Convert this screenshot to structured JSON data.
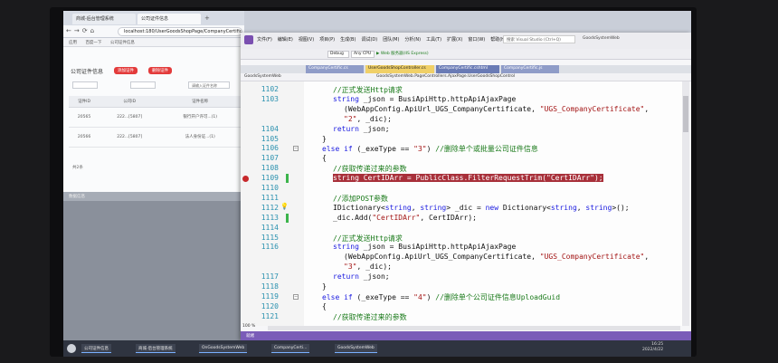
{
  "browser": {
    "tabs": [
      "商城-后台管理系统",
      "公司证件信息"
    ],
    "url": "localhost:180/UserGoodsShopPage/CompanyCertific.aspx",
    "bookmarks": [
      "应用",
      "百度一下",
      "公司证件信息"
    ],
    "panel_title": "公司证件信息",
    "buttons": [
      "添加证件",
      "删除证件"
    ],
    "search_placeholder": "请输入证件名称",
    "table": {
      "headers": [
        "",
        "证件ID",
        "公司ID",
        "证件名称"
      ],
      "rows": [
        [
          "",
          "20565",
          "222...[5807]",
          "银行开户许可...(1)"
        ],
        [
          "",
          "20566",
          "222...[5807]",
          "法人身份证...(1)"
        ]
      ]
    },
    "pager": "共2条",
    "footer": "数据信息"
  },
  "vs": {
    "menu": [
      "文件(F)",
      "编辑(E)",
      "视图(V)",
      "项目(P)",
      "生成(B)",
      "调试(D)",
      "团队(M)",
      "分析(N)",
      "工具(T)",
      "扩展(X)",
      "窗口(W)",
      "帮助(H)"
    ],
    "quick_launch": "搜索 Visual Studio (Ctrl+Q)",
    "user": "GoodsSystemWeb",
    "config": "Debug",
    "platform": "Any CPU",
    "run_label": "▶ Web 服务器(IIS Express)",
    "tabs": [
      "CompanyCertific.cs",
      "UserGoodsShopController.cs",
      "CompanyCertific.cshtml",
      "CompanyCertific.js"
    ],
    "active_tab_index": 1,
    "nav": [
      "GoodsSystemWeb",
      "GoodsSystemWeb.PageControllers.AjaxPage.UserGoodsShopControl"
    ],
    "zoom": "100 %",
    "status": "就绪",
    "output": "错误列表 输出",
    "position": "行 1113  列 35  字符 35  Ins"
  },
  "code_lines": [
    {
      "num": "1102",
      "indent": 2,
      "parts": [
        {
          "t": "//正式发送Http请求",
          "c": "cm"
        }
      ]
    },
    {
      "num": "1103",
      "indent": 2,
      "parts": [
        {
          "t": "string",
          "c": "kw"
        },
        {
          "t": " _json = BusiApiHttp.httpApiAjaxPage"
        }
      ]
    },
    {
      "num": "",
      "indent": 3,
      "parts": [
        {
          "t": "(WebAppConfig.ApiUrl_UGS_CompanyCertificate, "
        },
        {
          "t": "\"UGS_CompanyCertificate\"",
          "c": "str"
        },
        {
          "t": ","
        }
      ]
    },
    {
      "num": "",
      "indent": 3,
      "parts": [
        {
          "t": "\"2\"",
          "c": "str"
        },
        {
          "t": ", _dic);"
        }
      ]
    },
    {
      "num": "1104",
      "indent": 2,
      "parts": [
        {
          "t": "return",
          "c": "kw"
        },
        {
          "t": " _json;"
        }
      ]
    },
    {
      "num": "1105",
      "indent": 1,
      "parts": [
        {
          "t": "}"
        }
      ]
    },
    {
      "num": "1106",
      "indent": 1,
      "fold": true,
      "parts": [
        {
          "t": "else if",
          "c": "kw"
        },
        {
          "t": " (_exeType == "
        },
        {
          "t": "\"3\"",
          "c": "str"
        },
        {
          "t": ") "
        },
        {
          "t": "//删除单个或批量公司证件信息",
          "c": "cm"
        }
      ]
    },
    {
      "num": "1107",
      "indent": 1,
      "parts": [
        {
          "t": "{"
        }
      ]
    },
    {
      "num": "1108",
      "indent": 2,
      "parts": [
        {
          "t": "//获取传递过来的参数",
          "c": "cm"
        }
      ]
    },
    {
      "num": "1109",
      "indent": 2,
      "bp": true,
      "chg": true,
      "highlight": true,
      "parts": [
        {
          "t": "string CertIDArr = PublicClass.FilterRequestTrim(\"CertIDArr\");"
        }
      ]
    },
    {
      "num": "1110",
      "indent": 2,
      "parts": []
    },
    {
      "num": "1111",
      "indent": 2,
      "parts": [
        {
          "t": "//添加POST参数",
          "c": "cm"
        }
      ]
    },
    {
      "num": "1112",
      "indent": 2,
      "bulb": true,
      "parts": [
        {
          "t": "IDictionary<"
        },
        {
          "t": "string",
          "c": "kw"
        },
        {
          "t": ", "
        },
        {
          "t": "string",
          "c": "kw"
        },
        {
          "t": "> _dic = "
        },
        {
          "t": "new",
          "c": "kw"
        },
        {
          "t": " Dictionary<"
        },
        {
          "t": "string",
          "c": "kw"
        },
        {
          "t": ", "
        },
        {
          "t": "string",
          "c": "kw"
        },
        {
          "t": ">();"
        }
      ]
    },
    {
      "num": "1113",
      "indent": 2,
      "chg": true,
      "parts": [
        {
          "t": "_dic.Add("
        },
        {
          "t": "\"CertIDArr\"",
          "c": "str"
        },
        {
          "t": ", CertIDArr);"
        }
      ]
    },
    {
      "num": "1114",
      "indent": 2,
      "parts": []
    },
    {
      "num": "1115",
      "indent": 2,
      "parts": [
        {
          "t": "//正式发送Http请求",
          "c": "cm"
        }
      ]
    },
    {
      "num": "1116",
      "indent": 2,
      "parts": [
        {
          "t": "string",
          "c": "kw"
        },
        {
          "t": " _json = BusiApiHttp.httpApiAjaxPage"
        }
      ]
    },
    {
      "num": "",
      "indent": 3,
      "parts": [
        {
          "t": "(WebAppConfig.ApiUrl_UGS_CompanyCertificate, "
        },
        {
          "t": "\"UGS_CompanyCertificate\"",
          "c": "str"
        },
        {
          "t": ","
        }
      ]
    },
    {
      "num": "",
      "indent": 3,
      "parts": [
        {
          "t": "\"3\"",
          "c": "str"
        },
        {
          "t": ", _dic);"
        }
      ]
    },
    {
      "num": "1117",
      "indent": 2,
      "parts": [
        {
          "t": "return",
          "c": "kw"
        },
        {
          "t": " _json;"
        }
      ]
    },
    {
      "num": "1118",
      "indent": 1,
      "parts": [
        {
          "t": "}"
        }
      ]
    },
    {
      "num": "1119",
      "indent": 1,
      "fold": true,
      "parts": [
        {
          "t": "else if",
          "c": "kw"
        },
        {
          "t": " (_exeType == "
        },
        {
          "t": "\"4\"",
          "c": "str"
        },
        {
          "t": ") "
        },
        {
          "t": "//删除单个公司证件信息UploadGuid",
          "c": "cm"
        }
      ]
    },
    {
      "num": "1120",
      "indent": 1,
      "parts": [
        {
          "t": "{"
        }
      ]
    },
    {
      "num": "1121",
      "indent": 2,
      "parts": [
        {
          "t": "//获取传递过来的参数",
          "c": "cm"
        }
      ]
    }
  ],
  "taskbar": {
    "items": [
      "公司证件信息",
      "商城-后台管理系统",
      "OnGoodsSystemWeb",
      "CompanyCerti...",
      "GoodsSystemWeb"
    ],
    "time": "16:25",
    "date": "2022/4/22"
  }
}
